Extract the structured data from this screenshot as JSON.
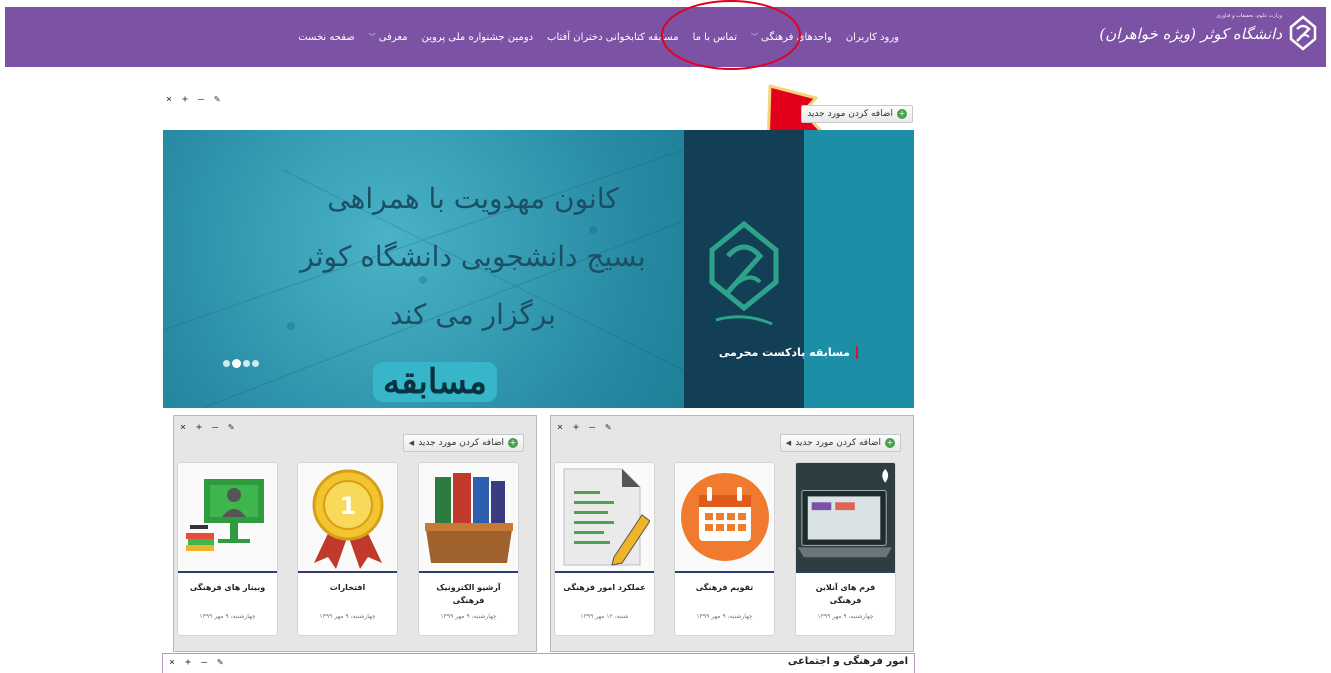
{
  "brand": {
    "name": "دانشگاه کوثر (ویژه خواهران)",
    "ministry": "وزارت علوم، تحقیقات و فناوری"
  },
  "nav": {
    "items": [
      {
        "label": "صفحه نخست",
        "has_dropdown": false
      },
      {
        "label": "معرفی",
        "has_dropdown": true
      },
      {
        "label": "دومین جشنواره ملی پروین",
        "has_dropdown": false
      },
      {
        "label": "مسابقه کتابخوانی دختران آفتاب",
        "has_dropdown": false
      },
      {
        "label": "تماس با ما",
        "has_dropdown": false
      },
      {
        "label": "واحدهای فرهنگی",
        "has_dropdown": true
      },
      {
        "label": "ورود کاربران",
        "has_dropdown": false
      }
    ]
  },
  "widget_tools": "× + – ✎",
  "add_new_label": "اضافه کردن مورد جدید",
  "banner": {
    "line1": "کانون مهدویت با همراهی",
    "line2": "بسیج دانشجویی دانشگاه کوثر",
    "line3": "برگزار می کند",
    "cta": "مسابقه",
    "caption": "مسابقه پادکست محرمی",
    "active_slide": 2,
    "slide_count": 4
  },
  "panel_right": {
    "cards": [
      {
        "title": "فرم های آنلاین فرهنگی",
        "date": "چهارشنبه، ۹ مهر ۱۳۹۹",
        "icon": "laptop-forms-icon"
      },
      {
        "title": "تقویم فرهنگی",
        "date": "چهارشنبه، ۹ مهر ۱۳۹۹",
        "icon": "calendar-icon"
      },
      {
        "title": "عملکرد امور فرهنگی",
        "date": "شنبه، ۱۲ مهر ۱۳۹۹",
        "icon": "document-pencil-icon"
      }
    ]
  },
  "panel_left": {
    "cards": [
      {
        "title": "آرشیو الکترونیک فرهنگی",
        "date": "چهارشنبه، ۹ مهر ۱۳۹۹",
        "icon": "books-archive-icon"
      },
      {
        "title": "افتخارات",
        "date": "چهارشنبه، ۹ مهر ۱۳۹۹",
        "icon": "medal-icon"
      },
      {
        "title": "وبینار های فرهنگی",
        "date": "چهارشنبه، ۹ مهر ۱۳۹۹",
        "icon": "webinar-icon"
      }
    ]
  },
  "bottom_section": {
    "title": "امور فرهنگی و اجتماعی"
  },
  "colors": {
    "nav_bg": "#7b52a4",
    "annotation": "#e3001b",
    "arrow_fill": "#e3001b",
    "arrow_border": "#f5d37a"
  }
}
